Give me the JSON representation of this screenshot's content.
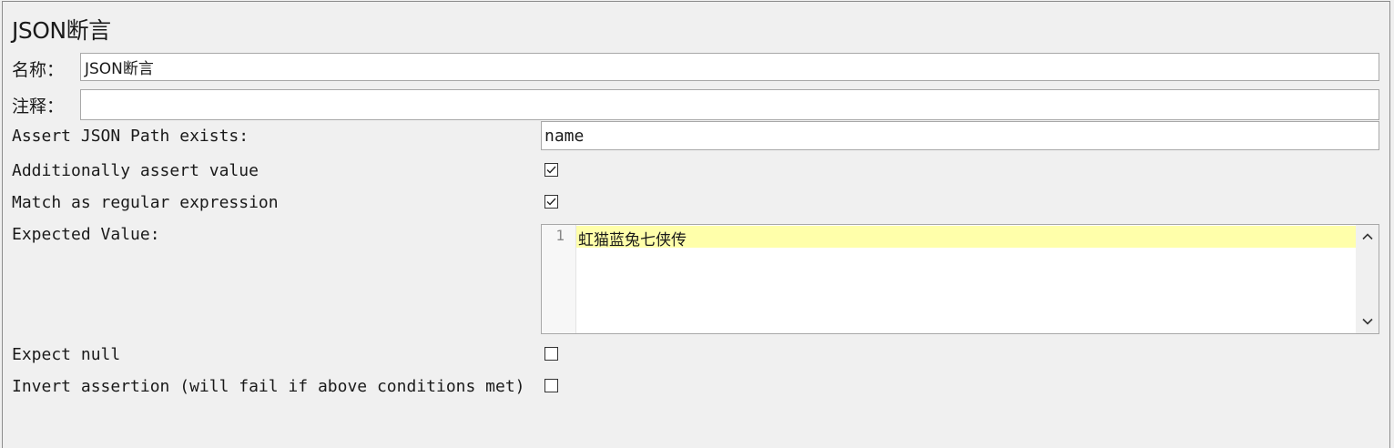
{
  "panel": {
    "title": "JSON断言",
    "name_label": "名称：",
    "name_value": "JSON断言",
    "comment_label": "注释：",
    "comment_value": ""
  },
  "fields": {
    "path_label": "Assert JSON Path exists:",
    "path_value": "name",
    "assert_value_label": "Additionally assert value",
    "assert_value_checked": true,
    "regex_label": "Match as regular expression",
    "regex_checked": true,
    "expected_label": "Expected Value:",
    "expected_line_number": "1",
    "expected_value": "虹猫蓝兔七侠传",
    "expect_null_label": "Expect null",
    "expect_null_checked": false,
    "invert_label": "Invert assertion (will fail if above conditions met)",
    "invert_checked": false
  },
  "icons": {
    "check": "check-icon",
    "scroll_up": "chevron-up-icon",
    "scroll_down": "chevron-down-icon"
  }
}
